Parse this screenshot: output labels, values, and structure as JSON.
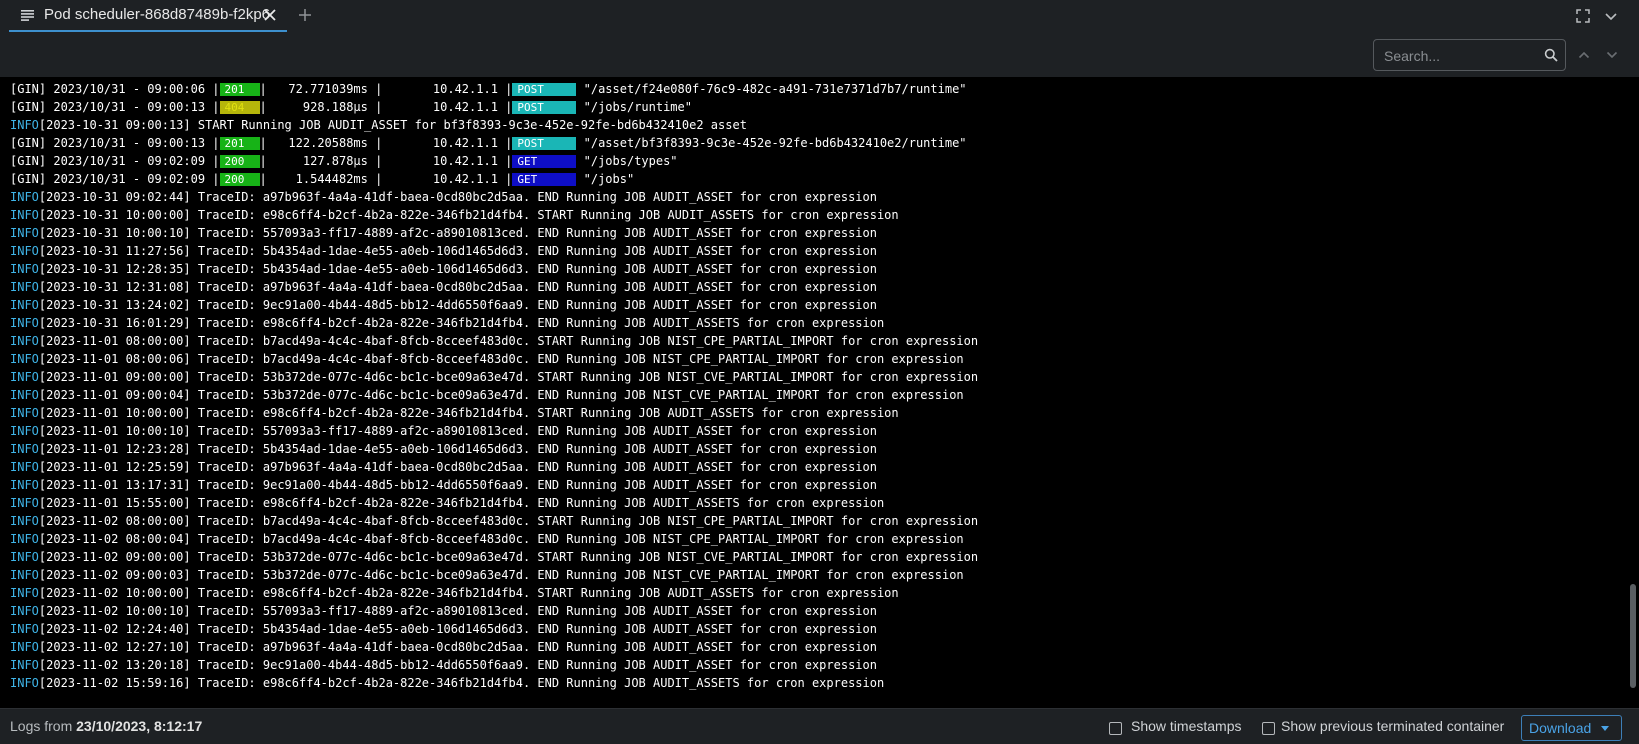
{
  "tab": {
    "title": "Pod scheduler-868d87489b-f2kp6",
    "icon": "document-lines-icon"
  },
  "search": {
    "placeholder": "Search..."
  },
  "colors": {
    "info_level": "#3fb5e8",
    "status_2xx": "#17b317",
    "status_4xx": "#b6b60b",
    "method_post": "#1ab6b6",
    "method_get": "#0e0ec6",
    "accent": "#3d90ce"
  },
  "log_lines": [
    {
      "kind": "gin",
      "prefix": "[GIN] 2023/10/31 - 09:00:06 |",
      "status": "201",
      "status_class": "2xx",
      "mid": "|   72.771039ms |       10.42.1.1 |",
      "method": "POST",
      "method_class": "post",
      "path": " \"/asset/f24e080f-76c9-482c-a491-731e7371d7b7/runtime\""
    },
    {
      "kind": "gin",
      "prefix": "[GIN] 2023/10/31 - 09:00:13 |",
      "status": "404",
      "status_class": "4xx",
      "mid": "|     928.188µs |       10.42.1.1 |",
      "method": "POST",
      "method_class": "post",
      "path": " \"/jobs/runtime\""
    },
    {
      "kind": "info",
      "level": "INFO",
      "text": "[2023-10-31 09:00:13] START Running JOB AUDIT_ASSET for bf3f8393-9c3e-452e-92fe-bd6b432410e2 asset"
    },
    {
      "kind": "gin",
      "prefix": "[GIN] 2023/10/31 - 09:00:13 |",
      "status": "201",
      "status_class": "2xx",
      "mid": "|   122.20588ms |       10.42.1.1 |",
      "method": "POST",
      "method_class": "post",
      "path": " \"/asset/bf3f8393-9c3e-452e-92fe-bd6b432410e2/runtime\""
    },
    {
      "kind": "gin",
      "prefix": "[GIN] 2023/10/31 - 09:02:09 |",
      "status": "200",
      "status_class": "2xx",
      "mid": "|     127.878µs |       10.42.1.1 |",
      "method": "GET",
      "method_class": "get",
      "path": " \"/jobs/types\""
    },
    {
      "kind": "gin",
      "prefix": "[GIN] 2023/10/31 - 09:02:09 |",
      "status": "200",
      "status_class": "2xx",
      "mid": "|    1.544482ms |       10.42.1.1 |",
      "method": "GET",
      "method_class": "get",
      "path": " \"/jobs\""
    },
    {
      "kind": "info",
      "level": "INFO",
      "text": "[2023-10-31 09:02:44] TraceID: a97b963f-4a4a-41df-baea-0cd80bc2d5aa. END Running JOB AUDIT_ASSET for cron expression"
    },
    {
      "kind": "info",
      "level": "INFO",
      "text": "[2023-10-31 10:00:00] TraceID: e98c6ff4-b2cf-4b2a-822e-346fb21d4fb4. START Running JOB AUDIT_ASSETS for cron expression"
    },
    {
      "kind": "info",
      "level": "INFO",
      "text": "[2023-10-31 10:00:10] TraceID: 557093a3-ff17-4889-af2c-a89010813ced. END Running JOB AUDIT_ASSET for cron expression"
    },
    {
      "kind": "info",
      "level": "INFO",
      "text": "[2023-10-31 11:27:56] TraceID: 5b4354ad-1dae-4e55-a0eb-106d1465d6d3. END Running JOB AUDIT_ASSET for cron expression"
    },
    {
      "kind": "info",
      "level": "INFO",
      "text": "[2023-10-31 12:28:35] TraceID: 5b4354ad-1dae-4e55-a0eb-106d1465d6d3. END Running JOB AUDIT_ASSET for cron expression"
    },
    {
      "kind": "info",
      "level": "INFO",
      "text": "[2023-10-31 12:31:08] TraceID: a97b963f-4a4a-41df-baea-0cd80bc2d5aa. END Running JOB AUDIT_ASSET for cron expression"
    },
    {
      "kind": "info",
      "level": "INFO",
      "text": "[2023-10-31 13:24:02] TraceID: 9ec91a00-4b44-48d5-bb12-4dd6550f6aa9. END Running JOB AUDIT_ASSET for cron expression"
    },
    {
      "kind": "info",
      "level": "INFO",
      "text": "[2023-10-31 16:01:29] TraceID: e98c6ff4-b2cf-4b2a-822e-346fb21d4fb4. END Running JOB AUDIT_ASSETS for cron expression"
    },
    {
      "kind": "info",
      "level": "INFO",
      "text": "[2023-11-01 08:00:00] TraceID: b7acd49a-4c4c-4baf-8fcb-8cceef483d0c. START Running JOB NIST_CPE_PARTIAL_IMPORT for cron expression"
    },
    {
      "kind": "info",
      "level": "INFO",
      "text": "[2023-11-01 08:00:06] TraceID: b7acd49a-4c4c-4baf-8fcb-8cceef483d0c. END Running JOB NIST_CPE_PARTIAL_IMPORT for cron expression"
    },
    {
      "kind": "info",
      "level": "INFO",
      "text": "[2023-11-01 09:00:00] TraceID: 53b372de-077c-4d6c-bc1c-bce09a63e47d. START Running JOB NIST_CVE_PARTIAL_IMPORT for cron expression"
    },
    {
      "kind": "info",
      "level": "INFO",
      "text": "[2023-11-01 09:00:04] TraceID: 53b372de-077c-4d6c-bc1c-bce09a63e47d. END Running JOB NIST_CVE_PARTIAL_IMPORT for cron expression"
    },
    {
      "kind": "info",
      "level": "INFO",
      "text": "[2023-11-01 10:00:00] TraceID: e98c6ff4-b2cf-4b2a-822e-346fb21d4fb4. START Running JOB AUDIT_ASSETS for cron expression"
    },
    {
      "kind": "info",
      "level": "INFO",
      "text": "[2023-11-01 10:00:10] TraceID: 557093a3-ff17-4889-af2c-a89010813ced. END Running JOB AUDIT_ASSET for cron expression"
    },
    {
      "kind": "info",
      "level": "INFO",
      "text": "[2023-11-01 12:23:28] TraceID: 5b4354ad-1dae-4e55-a0eb-106d1465d6d3. END Running JOB AUDIT_ASSET for cron expression"
    },
    {
      "kind": "info",
      "level": "INFO",
      "text": "[2023-11-01 12:25:59] TraceID: a97b963f-4a4a-41df-baea-0cd80bc2d5aa. END Running JOB AUDIT_ASSET for cron expression"
    },
    {
      "kind": "info",
      "level": "INFO",
      "text": "[2023-11-01 13:17:31] TraceID: 9ec91a00-4b44-48d5-bb12-4dd6550f6aa9. END Running JOB AUDIT_ASSET for cron expression"
    },
    {
      "kind": "info",
      "level": "INFO",
      "text": "[2023-11-01 15:55:00] TraceID: e98c6ff4-b2cf-4b2a-822e-346fb21d4fb4. END Running JOB AUDIT_ASSETS for cron expression"
    },
    {
      "kind": "info",
      "level": "INFO",
      "text": "[2023-11-02 08:00:00] TraceID: b7acd49a-4c4c-4baf-8fcb-8cceef483d0c. START Running JOB NIST_CPE_PARTIAL_IMPORT for cron expression"
    },
    {
      "kind": "info",
      "level": "INFO",
      "text": "[2023-11-02 08:00:04] TraceID: b7acd49a-4c4c-4baf-8fcb-8cceef483d0c. END Running JOB NIST_CPE_PARTIAL_IMPORT for cron expression"
    },
    {
      "kind": "info",
      "level": "INFO",
      "text": "[2023-11-02 09:00:00] TraceID: 53b372de-077c-4d6c-bc1c-bce09a63e47d. START Running JOB NIST_CVE_PARTIAL_IMPORT for cron expression"
    },
    {
      "kind": "info",
      "level": "INFO",
      "text": "[2023-11-02 09:00:03] TraceID: 53b372de-077c-4d6c-bc1c-bce09a63e47d. END Running JOB NIST_CVE_PARTIAL_IMPORT for cron expression"
    },
    {
      "kind": "info",
      "level": "INFO",
      "text": "[2023-11-02 10:00:00] TraceID: e98c6ff4-b2cf-4b2a-822e-346fb21d4fb4. START Running JOB AUDIT_ASSETS for cron expression"
    },
    {
      "kind": "info",
      "level": "INFO",
      "text": "[2023-11-02 10:00:10] TraceID: 557093a3-ff17-4889-af2c-a89010813ced. END Running JOB AUDIT_ASSET for cron expression"
    },
    {
      "kind": "info",
      "level": "INFO",
      "text": "[2023-11-02 12:24:40] TraceID: 5b4354ad-1dae-4e55-a0eb-106d1465d6d3. END Running JOB AUDIT_ASSET for cron expression"
    },
    {
      "kind": "info",
      "level": "INFO",
      "text": "[2023-11-02 12:27:10] TraceID: a97b963f-4a4a-41df-baea-0cd80bc2d5aa. END Running JOB AUDIT_ASSET for cron expression"
    },
    {
      "kind": "info",
      "level": "INFO",
      "text": "[2023-11-02 13:20:18] TraceID: 9ec91a00-4b44-48d5-bb12-4dd6550f6aa9. END Running JOB AUDIT_ASSET for cron expression"
    },
    {
      "kind": "info",
      "level": "INFO",
      "text": "[2023-11-02 15:59:16] TraceID: e98c6ff4-b2cf-4b2a-822e-346fb21d4fb4. END Running JOB AUDIT_ASSETS for cron expression"
    }
  ],
  "footer": {
    "logs_from_label": "Logs from",
    "logs_from_value": "23/10/2023, 8:12:17",
    "show_timestamps_label": "Show timestamps",
    "show_timestamps_checked": false,
    "show_previous_label": "Show previous terminated container",
    "show_previous_checked": false,
    "download_label": "Download"
  }
}
